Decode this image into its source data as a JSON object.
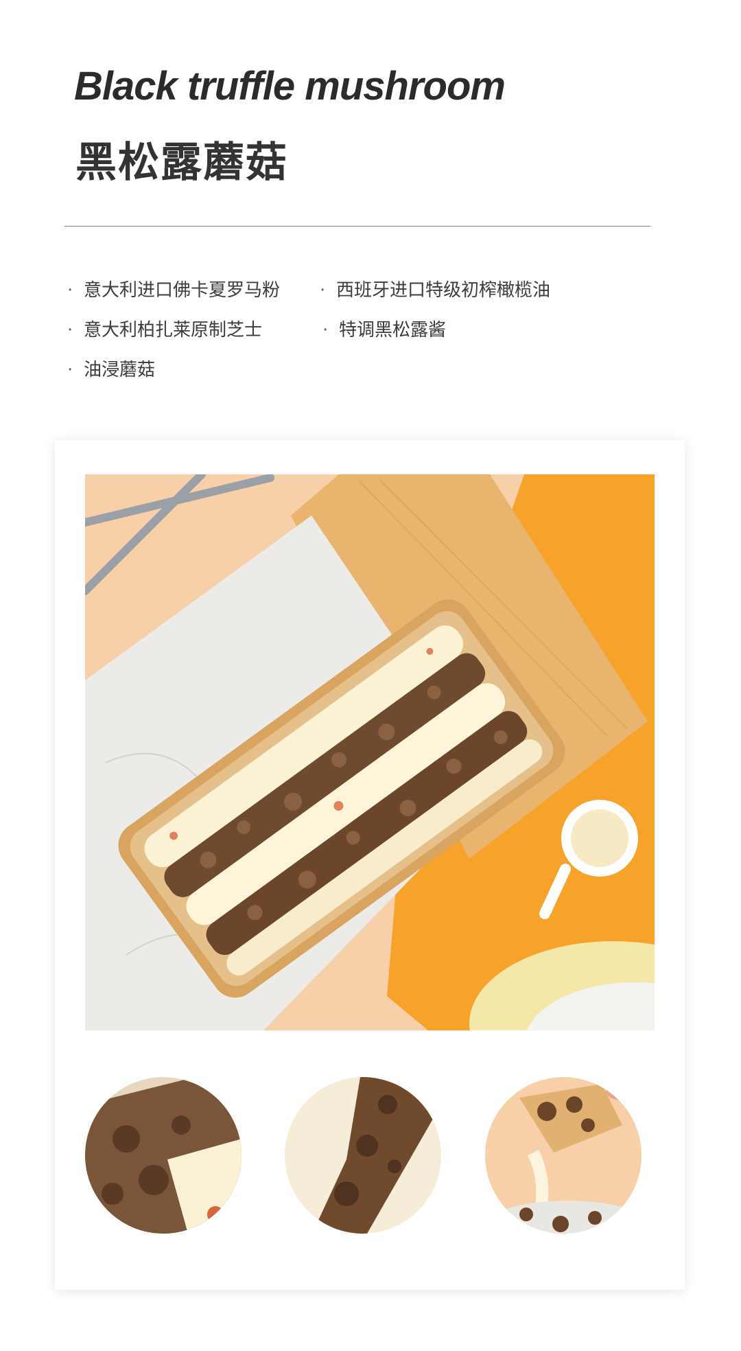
{
  "title_en": "Black truffle mushroom",
  "title_zh": "黑松露蘑菇",
  "ingredients": [
    "意大利进口佛卡夏罗马粉",
    "西班牙进口特级初榨橄榄油",
    "意大利柏扎莱原制芝士",
    "特调黑松露酱",
    "油浸蘑菇"
  ],
  "bullet": "·",
  "colors": {
    "background": "#ffffff",
    "divider": "#7a7a7a",
    "photo_backdrop": "#f6c9a1",
    "accent_orange": "#f7a22b"
  }
}
